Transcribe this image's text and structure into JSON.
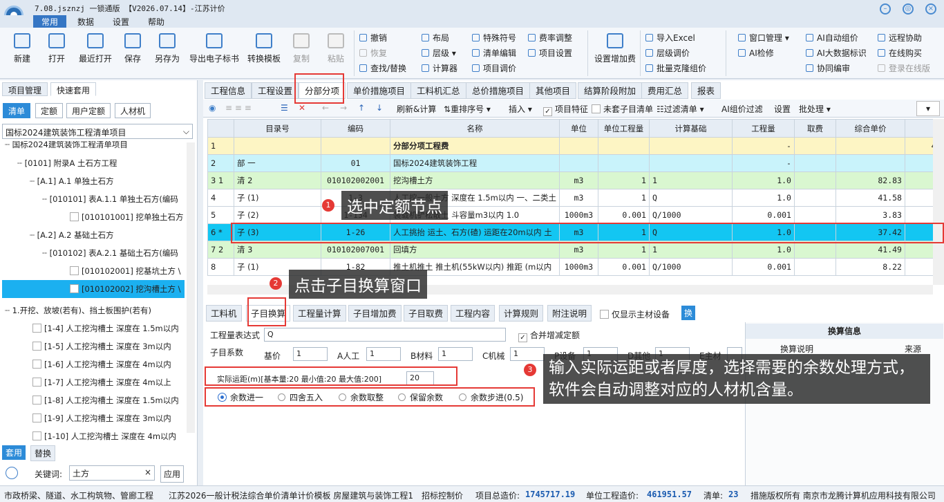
{
  "window": {
    "title": "7.08.jsznzj 一锁通版 【V2026.07.14】-江苏计价"
  },
  "menu": [
    "常用",
    "数据",
    "设置",
    "帮助"
  ],
  "ribbon": {
    "big": [
      "新建",
      "打开",
      "最近打开",
      "保存",
      "另存为",
      "导出电子标书",
      "转换模板",
      "复制",
      "粘贴"
    ],
    "edit": [
      "撤销",
      "恢复",
      "查找/替换"
    ],
    "layout": [
      "布局",
      "层级",
      "计算器"
    ],
    "special": [
      "特殊符号",
      "清单编辑",
      "项目调价"
    ],
    "rate": [
      "费率调整",
      "项目设置"
    ],
    "surcharge": "设置增加费",
    "excel": [
      "导入Excel",
      "层级调价",
      "批量克隆组价"
    ],
    "window": [
      "窗口管理",
      "AI检修"
    ],
    "ai": [
      "AI自动组价",
      "AI大数据标识",
      "协同编审"
    ],
    "remote": [
      "远程协助",
      "在线购买",
      "登录在线版"
    ]
  },
  "left": {
    "tabs": [
      "项目管理",
      "快速套用"
    ],
    "buttons": [
      "清单",
      "定额",
      "用户定额",
      "人材机"
    ],
    "select": "国标2024建筑装饰工程清单项目",
    "tree": [
      "国标2024建筑装饰工程清单项目",
      "[0101] 附录A 土石方工程",
      "[A.1] A.1 单独土石方",
      "[010101] 表A.1.1 单独土石方(编码",
      "[010101001] 挖单独土石方 \\",
      "[A.2] A.2 基础土石方",
      "[010102] 表A.2.1 基础土石方(编码",
      "[010102001] 挖基坑土方 \\",
      "[010102002] 挖沟槽土方 \\"
    ],
    "group": "1.开挖、放坡(若有)、挡土板围护(若有)",
    "items": [
      "[1-4] 人工挖沟槽土 深度在 1.5m以内",
      "[1-5] 人工挖沟槽土 深度在 3m以内",
      "[1-6] 人工挖沟槽土 深度在 4m以内",
      "[1-7] 人工挖沟槽土 深度在 4m以上",
      "[1-8] 人工挖沟槽土 深度在 1.5m以内",
      "[1-9] 人工挖沟槽土 深度在 3m以内",
      "[1-10] 人工挖沟槽土 深度在 4m以内"
    ],
    "bottom_tabs": [
      "套用",
      "替换"
    ],
    "keyword_label": "关键词:",
    "keyword": "土方",
    "apply": "应用"
  },
  "top_tabs": [
    "工程信息",
    "工程设置",
    "分部分项",
    "单价措施项目",
    "工料机汇总",
    "总价措施项目",
    "其他项目",
    "结算阶段附加",
    "费用汇总",
    "报表"
  ],
  "toolbar": [
    "刷新&计算",
    "重排序号",
    "插入",
    "项目特征",
    "未套子目清单",
    "过滤清单",
    "AI组价过滤",
    "设置",
    "批处理"
  ],
  "grid": {
    "headers": [
      "",
      "目录号",
      "编码",
      "名称",
      "单位",
      "单位工程量",
      "计算基础",
      "工程量",
      "取费",
      "综合单价",
      ""
    ],
    "rows": [
      {
        "n": "1",
        "dir": "",
        "code": "",
        "name": "分部分项工程费",
        "unit": "",
        "uq": "",
        "base": "",
        "qty": "-",
        "fee": "",
        "price": "",
        "x": "4",
        "cls": "r-yellow"
      },
      {
        "n": "2",
        "dir": "部  一",
        "code": "01",
        "name": "国标2024建筑装饰工程",
        "unit": "",
        "uq": "",
        "base": "",
        "qty": "-",
        "fee": "",
        "price": "",
        "x": "",
        "cls": "r-cyan"
      },
      {
        "n": "3  1",
        "dir": "清  2",
        "code": "010102002001",
        "name": "挖沟槽土方",
        "unit": "m3",
        "uq": "1",
        "base": "1",
        "qty": "1.0",
        "fee": "",
        "price": "82.83",
        "x": "",
        "cls": "r-green"
      },
      {
        "n": "4",
        "dir": "子  (1)",
        "code": "1-3",
        "name": "人工挖一般土方 深度在 1.5m以内 一、二类土",
        "unit": "m3",
        "uq": "1",
        "base": "Q",
        "qty": "1.0",
        "fee": "",
        "price": "41.58",
        "x": "",
        "cls": ""
      },
      {
        "n": "5",
        "dir": "子  (2)",
        "code": "1-134",
        "name": "装载机铲松散土 斗容量m3以内 1.0",
        "unit": "1000m3",
        "uq": "0.001",
        "base": "Q/1000",
        "qty": "0.001",
        "fee": "",
        "price": "3.83",
        "x": "",
        "cls": ""
      },
      {
        "n": "6 *",
        "dir": "子  (3)",
        "code": "1-26",
        "name": "人工挑抬 运土、石方(碴) 运距在20m以内 土",
        "unit": "m3",
        "uq": "1",
        "base": "Q",
        "qty": "1.0",
        "fee": "",
        "price": "37.42",
        "x": "",
        "cls": "r-sel"
      },
      {
        "n": "7  2",
        "dir": "清  3",
        "code": "010102007001",
        "name": "回填方",
        "unit": "m3",
        "uq": "1",
        "base": "1",
        "qty": "1.0",
        "fee": "",
        "price": "41.49",
        "x": "",
        "cls": "r-green"
      },
      {
        "n": "8",
        "dir": "子  (1)",
        "code": "1-82",
        "name": "推土机推土 推土机(55kW以内) 推距 (m以内",
        "unit": "1000m3",
        "uq": "0.001",
        "base": "Q/1000",
        "qty": "0.001",
        "fee": "",
        "price": "8.22",
        "x": "",
        "cls": ""
      }
    ]
  },
  "bottom_tabs": [
    "工料机",
    "子目换算",
    "工程量计算",
    "子目增加费",
    "子目取费",
    "工程内容",
    "计算规则",
    "附注说明"
  ],
  "only_main": "仅显示主材设备",
  "huan": "换",
  "form": {
    "expr_label": "工程量表达式",
    "expr": "Q",
    "merge": "合并增减定额",
    "coef_label": "子目系数",
    "coefs": [
      {
        "l": "基价",
        "v": "1"
      },
      {
        "l": "A人工",
        "v": "1"
      },
      {
        "l": "B材料",
        "v": "1"
      },
      {
        "l": "C机械",
        "v": "1"
      },
      {
        "l": "P设备",
        "v": "1"
      },
      {
        "l": "D其他",
        "v": "1"
      },
      {
        "l": "E主材",
        "v": ""
      }
    ],
    "distance_label": "实际运距(m)[基本量:20 最小值:20 最大值:200]",
    "distance": "20",
    "radios": [
      "余数进一",
      "四舍五入",
      "余数取整",
      "保留余数",
      "余数步进(0.5)"
    ]
  },
  "info": {
    "title": "换算信息",
    "c1": "换算说明",
    "c2": "来源"
  },
  "callouts": {
    "c1": "选中定额节点",
    "c2": "点击子目换算窗口",
    "c3": "输入实际运距或者厚度，选择需要的余数处理方式，软件会自动调整对应的人材机含量。"
  },
  "status": {
    "s1": "市政桥梁、隧道、水工构筑物、管廊工程",
    "s2": "江苏2026一般计税法综合单价清单计价模板 房屋建筑与装饰工程1",
    "s3": "招标控制价",
    "s4l": "项目总造价:",
    "s4": "1745717.19",
    "s5l": "单位工程造价:",
    "s5": "461951.57",
    "s6l": "清单:",
    "s6": "23",
    "s7": "措施版权所有 南京市龙腾计算机应用科技有限公司"
  },
  "colors": {
    "accent": "#3576c4",
    "selected": "#13c6f2",
    "callout_red": "#e53935"
  }
}
